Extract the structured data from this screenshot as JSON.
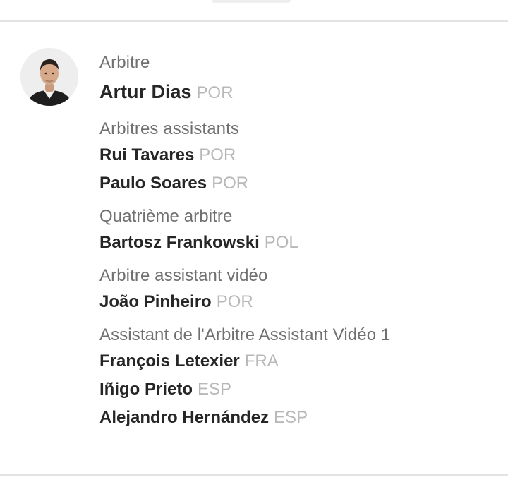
{
  "officials": {
    "referee": {
      "role": "Arbitre",
      "people": [
        {
          "name": "Artur Dias",
          "nationality": "POR"
        }
      ]
    },
    "assistants": {
      "role": "Arbitres assistants",
      "people": [
        {
          "name": "Rui Tavares",
          "nationality": "POR"
        },
        {
          "name": "Paulo Soares",
          "nationality": "POR"
        }
      ]
    },
    "fourth": {
      "role": "Quatrième arbitre",
      "people": [
        {
          "name": "Bartosz Frankowski",
          "nationality": "POL"
        }
      ]
    },
    "var": {
      "role": "Arbitre assistant vidéo",
      "people": [
        {
          "name": "João Pinheiro",
          "nationality": "POR"
        }
      ]
    },
    "avar": {
      "role": "Assistant de l'Arbitre Assistant Vidéo 1",
      "people": [
        {
          "name": "François Letexier",
          "nationality": "FRA"
        },
        {
          "name": "Iñigo Prieto",
          "nationality": "ESP"
        },
        {
          "name": "Alejandro Hernández",
          "nationality": "ESP"
        }
      ]
    }
  },
  "avatar": {
    "icon": "referee-portrait",
    "bg": "#f0f0f0"
  },
  "colors": {
    "role": "#707070",
    "name": "#262626",
    "nationality": "#b8b8b8",
    "divider": "#e3e3e3"
  }
}
